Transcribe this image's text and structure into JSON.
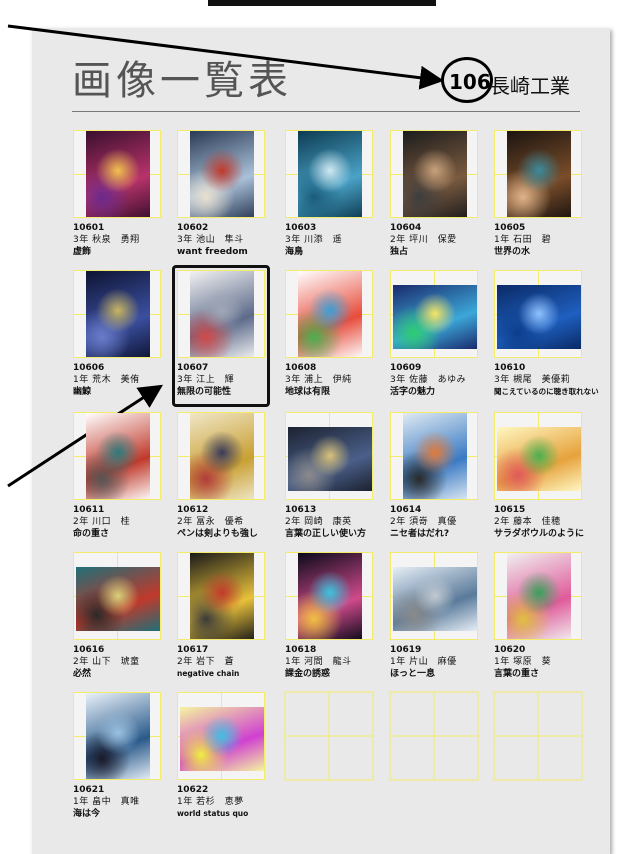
{
  "header": {
    "title": "画像一覧表",
    "school_number": "106",
    "school_name": "長崎工業"
  },
  "items": [
    {
      "id": "10601",
      "name": "3年 秋泉　勇翔",
      "title": "虚飾",
      "palette": [
        "#3a0f2e",
        "#b8336a",
        "#f2c14e",
        "#6b2a8c"
      ]
    },
    {
      "id": "10602",
      "name": "3年 池山　隼斗",
      "title": "want freedom",
      "palette": [
        "#2b3a55",
        "#a9c1d9",
        "#c0392b",
        "#e8e0d0"
      ]
    },
    {
      "id": "10603",
      "name": "3年 川添　遥",
      "title": "海鳥",
      "palette": [
        "#0d3b52",
        "#4aa3c7",
        "#cfe8f2",
        "#1a5c7a"
      ]
    },
    {
      "id": "10604",
      "name": "2年 坪川　保愛",
      "title": "独占",
      "palette": [
        "#1c1c1c",
        "#7a5a40",
        "#c9a27c",
        "#3d3d3d"
      ]
    },
    {
      "id": "10605",
      "name": "1年 石田　碧",
      "title": "世界の水",
      "palette": [
        "#1b1410",
        "#7a4d2a",
        "#3c8a9c",
        "#e0b48a"
      ]
    },
    {
      "id": "10606",
      "name": "1年 荒木　美侑",
      "title": "幽鯨",
      "palette": [
        "#0e1433",
        "#3b4fa0",
        "#c8b560",
        "#6a7cc8"
      ]
    },
    {
      "id": "10607",
      "name": "3年 江上　輝",
      "title": "無限の可能性",
      "palette": [
        "#f2f2f2",
        "#5c6a8a",
        "#a0a7b8",
        "#d04a4a"
      ]
    },
    {
      "id": "10608",
      "name": "3年 浦上　伊純",
      "title": "地球は有限",
      "palette": [
        "#ffffff",
        "#e74c3c",
        "#3aa0d8",
        "#4caf50"
      ]
    },
    {
      "id": "10609",
      "name": "3年 佐藤　あゆみ",
      "title": "活字の魅力",
      "palette": [
        "#1a2a6c",
        "#3ca7d9",
        "#f5e663",
        "#2ecc71"
      ]
    },
    {
      "id": "10610",
      "name": "3年 槻尾　美優莉",
      "title": "聞こえているのに聴き取れない",
      "palette": [
        "#0a2a66",
        "#1f5fbf",
        "#8fc2ff",
        "#0d3d8a"
      ]
    },
    {
      "id": "10611",
      "name": "2年 川口　桂",
      "title": "命の重さ",
      "palette": [
        "#ffffff",
        "#c0392b",
        "#2c7a7b",
        "#555555"
      ]
    },
    {
      "id": "10612",
      "name": "2年 冨永　優希",
      "title": "ペンは剣よりも強し",
      "palette": [
        "#f0e6c8",
        "#c8a032",
        "#3a3a5a",
        "#b23c3c"
      ]
    },
    {
      "id": "10613",
      "name": "2年 岡崎　康英",
      "title": "言葉の正しい使い方",
      "palette": [
        "#1c2230",
        "#4a5f8a",
        "#d9c27a",
        "#8a8a8a"
      ]
    },
    {
      "id": "10614",
      "name": "2年 須嵜　真優",
      "title": "ニセ者はだれ?",
      "palette": [
        "#dfeaf2",
        "#3a7ac4",
        "#e07a3a",
        "#2a2a2a"
      ]
    },
    {
      "id": "10615",
      "name": "2年 藤本　佳穂",
      "title": "サラダボウルのように",
      "palette": [
        "#fff7c2",
        "#e6a23c",
        "#4caf50",
        "#e05a5a"
      ]
    },
    {
      "id": "10616",
      "name": "2年 山下　琥童",
      "title": "必然",
      "palette": [
        "#1f6f78",
        "#c0392b",
        "#d8d07a",
        "#2a2a2a"
      ]
    },
    {
      "id": "10617",
      "name": "2年 岩下　蒼",
      "title": "negative chain",
      "palette": [
        "#1a1a1a",
        "#e8c23a",
        "#c0392b",
        "#3a3a3a"
      ]
    },
    {
      "id": "10618",
      "name": "1年 河間　龍斗",
      "title": "課金の誘惑",
      "palette": [
        "#0a0a1a",
        "#d04a8a",
        "#3ac4e0",
        "#f0c040"
      ]
    },
    {
      "id": "10619",
      "name": "1年 片山　麻優",
      "title": "ほっと一息",
      "palette": [
        "#e6eef6",
        "#5a7a9a",
        "#c0c8d0",
        "#8a8a8a"
      ]
    },
    {
      "id": "10620",
      "name": "1年 塚原　葵",
      "title": "言葉の重さ",
      "palette": [
        "#f0f0f0",
        "#e05a9a",
        "#3aa05a",
        "#e0c040"
      ]
    },
    {
      "id": "10621",
      "name": "1年 畠中　真唯",
      "title": "海は今",
      "palette": [
        "#eaf2fa",
        "#2a5a8a",
        "#9ac0e0",
        "#1a1a2a"
      ]
    },
    {
      "id": "10622",
      "name": "1年 若杉　恵夢",
      "title": "world status quo",
      "palette": [
        "#f5f5a0",
        "#d040d0",
        "#40c0e0",
        "#f0f040"
      ]
    }
  ],
  "colors": {
    "grid_line": "#f3ec6b",
    "page_bg": "#e9e9e9",
    "highlight": "#111111"
  }
}
